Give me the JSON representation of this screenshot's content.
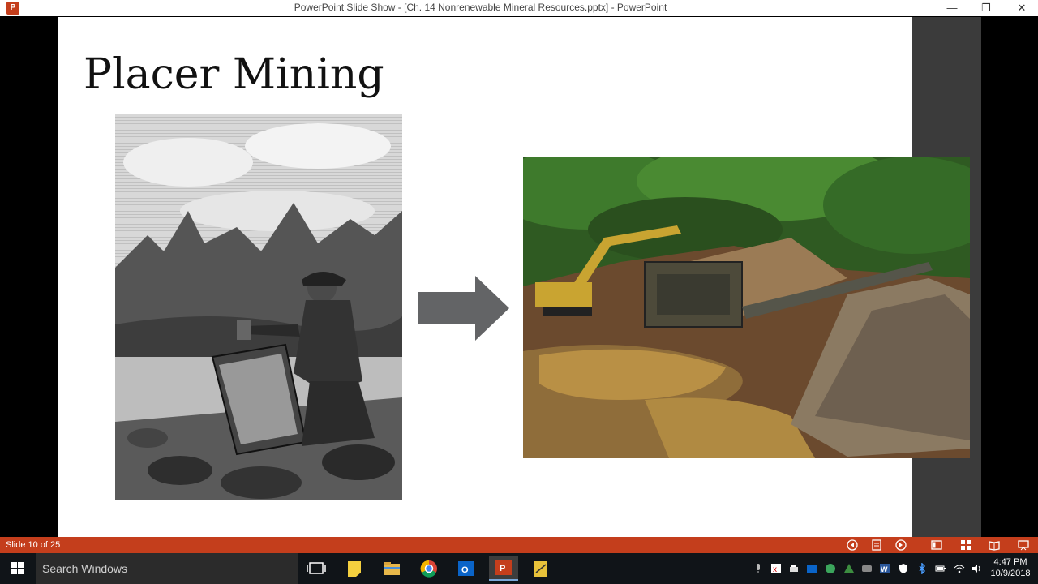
{
  "window": {
    "title": "PowerPoint Slide Show - [Ch. 14 Nonrenewable Mineral Resources.pptx] - PowerPoint",
    "app_icon": "P"
  },
  "slide": {
    "title": "Placer Mining",
    "left_image": "engraving-miner-panning-for-gold",
    "right_image": "photo-mechanized-placer-mine"
  },
  "statusbar": {
    "slide_count": "Slide 10 of 25",
    "bg_color": "#c43e1c"
  },
  "taskbar": {
    "search_placeholder": "Search Windows",
    "clock_time": "4:47 PM",
    "clock_date": "10/9/2018"
  }
}
